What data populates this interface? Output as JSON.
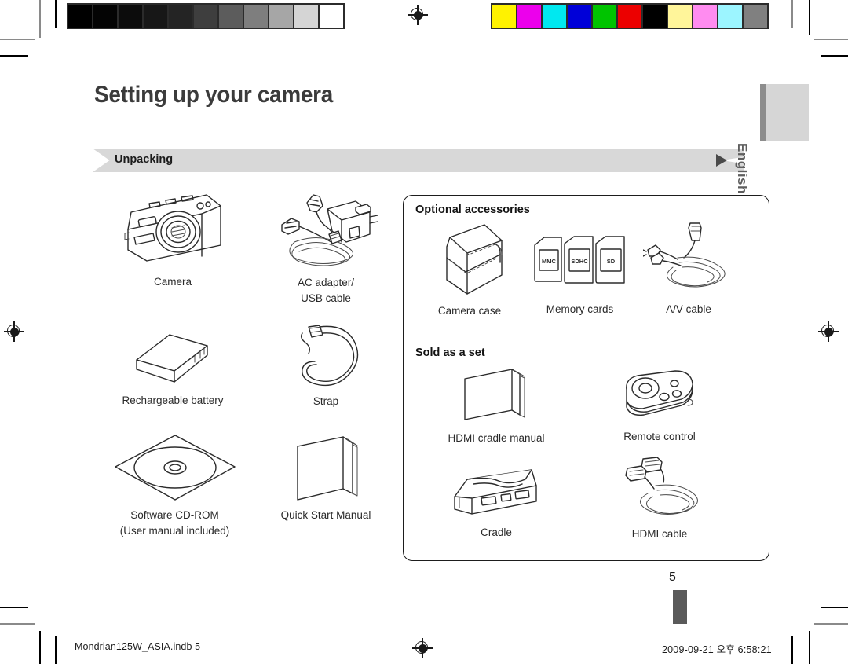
{
  "page": {
    "title": "Setting up your camera",
    "section_label": "Unpacking",
    "language_tab": "English",
    "page_number": "5"
  },
  "footer": {
    "file_name": "Mondrian125W_ASIA.indb   5",
    "timestamp": "2009-09-21   오후 6:58:21"
  },
  "included_items": [
    {
      "name": "camera",
      "caption": "Camera"
    },
    {
      "name": "ac-adapter-usb-cable",
      "caption": "AC adapter/\nUSB cable"
    },
    {
      "name": "rechargeable-battery",
      "caption": "Rechargeable battery"
    },
    {
      "name": "strap",
      "caption": "Strap"
    },
    {
      "name": "software-cd-rom",
      "caption": "Software CD-ROM\n(User manual included)"
    },
    {
      "name": "quick-start-manual",
      "caption": "Quick Start Manual"
    }
  ],
  "panel": {
    "optional_heading": "Optional accessories",
    "optional_items": [
      {
        "name": "camera-case",
        "caption": "Camera case"
      },
      {
        "name": "memory-cards",
        "caption": "Memory cards"
      },
      {
        "name": "av-cable",
        "caption": "A/V cable"
      }
    ],
    "memory_card_labels": [
      "MMC",
      "SDHC",
      "SD"
    ],
    "set_heading": "Sold as a set",
    "set_items": [
      {
        "name": "hdmi-cradle-manual",
        "caption": "HDMI cradle manual"
      },
      {
        "name": "remote-control",
        "caption": "Remote control"
      },
      {
        "name": "cradle",
        "caption": "Cradle"
      },
      {
        "name": "hdmi-cable",
        "caption": "HDMI cable"
      }
    ]
  },
  "print_marks": {
    "gray_wedge": [
      "#000000",
      "#040404",
      "#0c0c0c",
      "#171717",
      "#242424",
      "#3e3e3e",
      "#5c5c5c",
      "#7e7e7e",
      "#a6a6a6",
      "#d5d5d5",
      "#ffffff"
    ],
    "color_bar": [
      "#fff200",
      "#ec00ec",
      "#00e8f0",
      "#0000d8",
      "#00c400",
      "#ec0000",
      "#000000",
      "#fff59a",
      "#ff8cf0",
      "#9cf5ff",
      "#808080"
    ]
  },
  "colors": {
    "banner_bg": "#d8d8d8",
    "tab_bg": "#d6d6d6",
    "tab_spine": "#8d8d8d",
    "index_bar": "#5a5a5a",
    "line": "#2b2b2b"
  }
}
